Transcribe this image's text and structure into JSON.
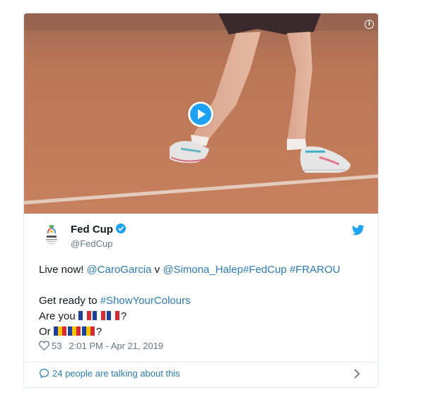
{
  "media": {
    "info_glyph": "i",
    "play_icon": "play-icon",
    "colors": {
      "clay": "#c07a5a",
      "play_accent": "#1da1f2"
    }
  },
  "author": {
    "name": "Fed Cup",
    "handle": "@FedCup",
    "verified_icon": "verified-badge-icon",
    "logo_icon": "fed-cup-logo-icon"
  },
  "platform_icon": "twitter-bird-icon",
  "tweet": {
    "line1": {
      "prefix": "Live now! ",
      "mention1": "@CaroGarcia",
      "middle": " v ",
      "mention2": "@Simona_Halep",
      "hashtag1": "#FedCup",
      "space": " ",
      "hashtag2": "#FRAROU"
    },
    "line2": {
      "prefix": "Get ready to ",
      "hashtag": "#ShowYourColours"
    },
    "line3": {
      "prefix": "Are you ",
      "suffix": "?"
    },
    "line4": {
      "prefix": "Or ",
      "suffix": "?"
    },
    "flags": {
      "france": "flag-france-icon",
      "romania": "flag-romania-icon"
    }
  },
  "meta": {
    "likes": "53",
    "timestamp": "2:01 PM - Apr 21, 2019"
  },
  "conversation": {
    "label": "24 people are talking about this"
  },
  "colors": {
    "link": "#2b7bb9",
    "muted": "#657786",
    "border": "#e1e8ed"
  }
}
